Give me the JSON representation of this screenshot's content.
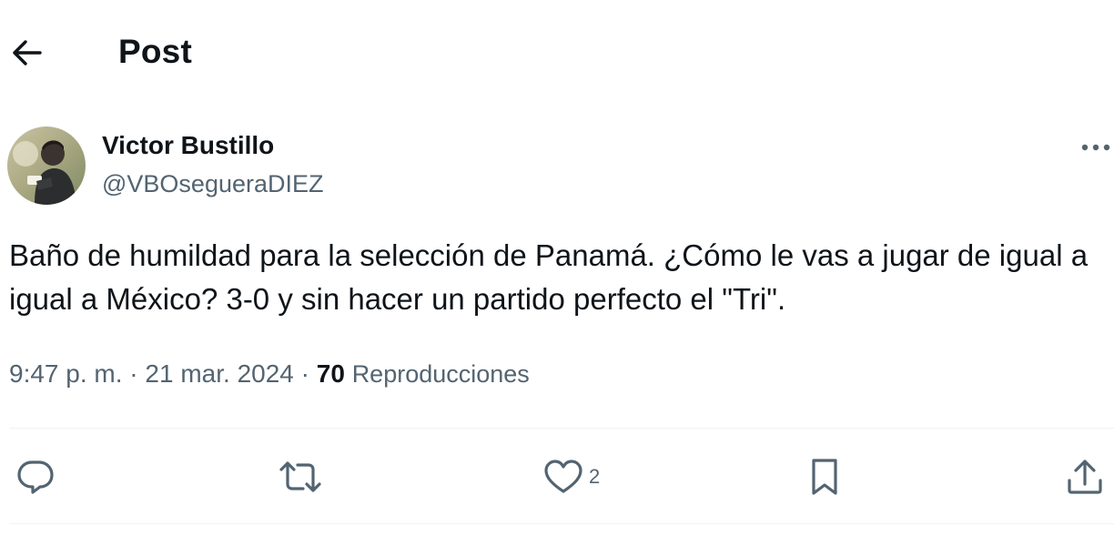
{
  "header": {
    "back_icon": "arrow-left-icon",
    "title": "Post"
  },
  "author": {
    "name": "Victor Bustillo",
    "handle": "@VBOsegueraDIEZ",
    "avatar_icon": "user-avatar"
  },
  "tweet": {
    "text": "Baño de humildad para la selección de Panamá. ¿Cómo le vas a jugar de igual a igual a México? 3-0 y sin hacer un partido perfecto el \"Tri\".",
    "time": "9:47 p. m.",
    "separator": "·",
    "date": "21 mar. 2024",
    "views_count": "70",
    "views_label": "Reproducciones"
  },
  "actions": {
    "reply_icon": "reply-icon",
    "retweet_icon": "retweet-icon",
    "like_icon": "heart-icon",
    "like_count": "2",
    "bookmark_icon": "bookmark-icon",
    "share_icon": "share-icon"
  },
  "colors": {
    "text_primary": "#0f1419",
    "text_secondary": "#536471",
    "divider": "#eff3f4"
  }
}
